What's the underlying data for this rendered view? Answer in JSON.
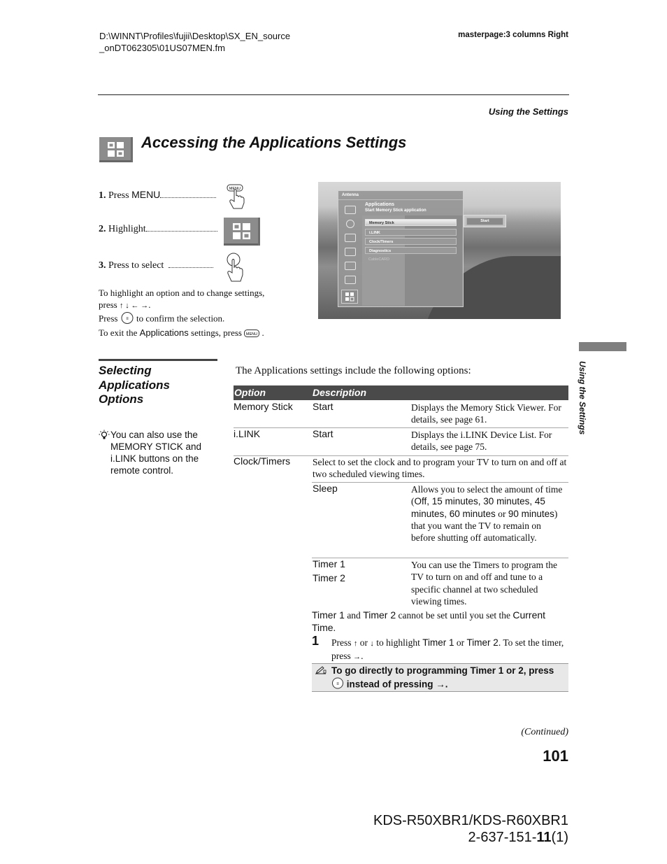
{
  "header": {
    "file_path_line1": "D:\\WINNT\\Profiles\\fujii\\Desktop\\SX_EN_source",
    "file_path_line2": "_onDT062305\\01US07MEN.fm",
    "masterpage": "masterpage:3 columns Right",
    "section": "Using the Settings"
  },
  "title": {
    "icon": "applications-icon",
    "text": "Accessing the Applications Settings"
  },
  "steps": [
    {
      "num": "1.",
      "text": "Press ",
      "key": "MENU",
      "icon": "menu-button-press-icon"
    },
    {
      "num": "2.",
      "text": "Highlight",
      "icon": "applications-icon"
    },
    {
      "num": "3.",
      "text": "Press to select",
      "icon": "select-button-press-icon"
    }
  ],
  "instructions": {
    "line1": "To highlight an option and to change settings,",
    "line2_prefix": "press",
    "arrows": "↑ ↓ ← →",
    "line3_prefix": "Press",
    "line3_suffix": "to confirm the selection.",
    "line4_prefix": "To exit the",
    "line4_app": "Applications",
    "line4_suffix": "settings, press",
    "menu_key": "MENU"
  },
  "tv_screen": {
    "header": "Antenna",
    "app_title": "Applications",
    "app_subtitle": "Start Memory Stick application",
    "items": [
      {
        "label": "Memory Stick",
        "state": "highlighted"
      },
      {
        "label": "i.LINK",
        "state": "normal"
      },
      {
        "label": "Clock/Timers",
        "state": "normal"
      },
      {
        "label": "Diagnostics",
        "state": "normal"
      },
      {
        "label": "CableCARD",
        "state": "disabled"
      }
    ],
    "action_button": "Start",
    "sidebar_icons": [
      "picture-icon",
      "sound-icon",
      "screen-icon",
      "channel-icon",
      "parental-lock-icon",
      "setup-icon",
      "applications-icon"
    ]
  },
  "subsection": {
    "title_line1": "Selecting",
    "title_line2": "Applications",
    "title_line3": "Options",
    "tip": "You can also use the MEMORY STICK and i.LINK buttons on the remote control."
  },
  "table": {
    "intro": "The Applications settings include the following options:",
    "headers": [
      "Option",
      "Description"
    ],
    "rows": [
      {
        "option": "Memory Stick",
        "setting": "Start",
        "desc": "Displays the Memory Stick Viewer. For details, see page 61."
      },
      {
        "option": "i.LINK",
        "setting": "Start",
        "desc": "Displays the i.LINK Device List. For details, see page 75."
      },
      {
        "option": "Clock/Timers",
        "summary": "Select to set the clock and to program your TV to turn on and off at two scheduled viewing times.",
        "subrows": [
          {
            "setting": "Sleep",
            "desc_parts": [
              "Allows you to select the amount of time (",
              "Off, 15 minutes, 30 minutes, 45 minutes, 60 minutes",
              " or ",
              "90 minutes",
              ") that you want the TV to remain on before shutting off automatically."
            ]
          },
          {
            "setting": "Timer 1",
            "setting2": "Timer 2",
            "desc": "You can use the Timers to program the TV to turn on and off and tune to a specific channel at two scheduled viewing times."
          }
        ]
      }
    ],
    "timer_note": {
      "t1": "Timer 1",
      "and": " and ",
      "t2": "Timer 2",
      "mid": " cannot be set until you set the ",
      "ct": "Current Time",
      "end": "."
    },
    "step": {
      "num": "1",
      "p1": "Press ",
      "up": "↑",
      "or": " or ",
      "down": "↓",
      "p2": " to highlight ",
      "t1": "Timer 1",
      "or2": " or ",
      "t2": "Timer 2",
      "p3": ". To set the timer, press ",
      "right": "→",
      "end": "."
    },
    "note": {
      "icon": "pencil-note-icon",
      "line1": "To go directly to programming Timer 1 or 2, press",
      "line2": "instead of pressing →."
    }
  },
  "side_tab": {
    "label": "Using the Settings"
  },
  "footer": {
    "continued": "(Continued)",
    "page_number": "101",
    "model": "KDS-R50XBR1/KDS-R60XBR1",
    "code_prefix": "2-637-151-",
    "code_bold": "11",
    "code_suffix": "(1)"
  }
}
